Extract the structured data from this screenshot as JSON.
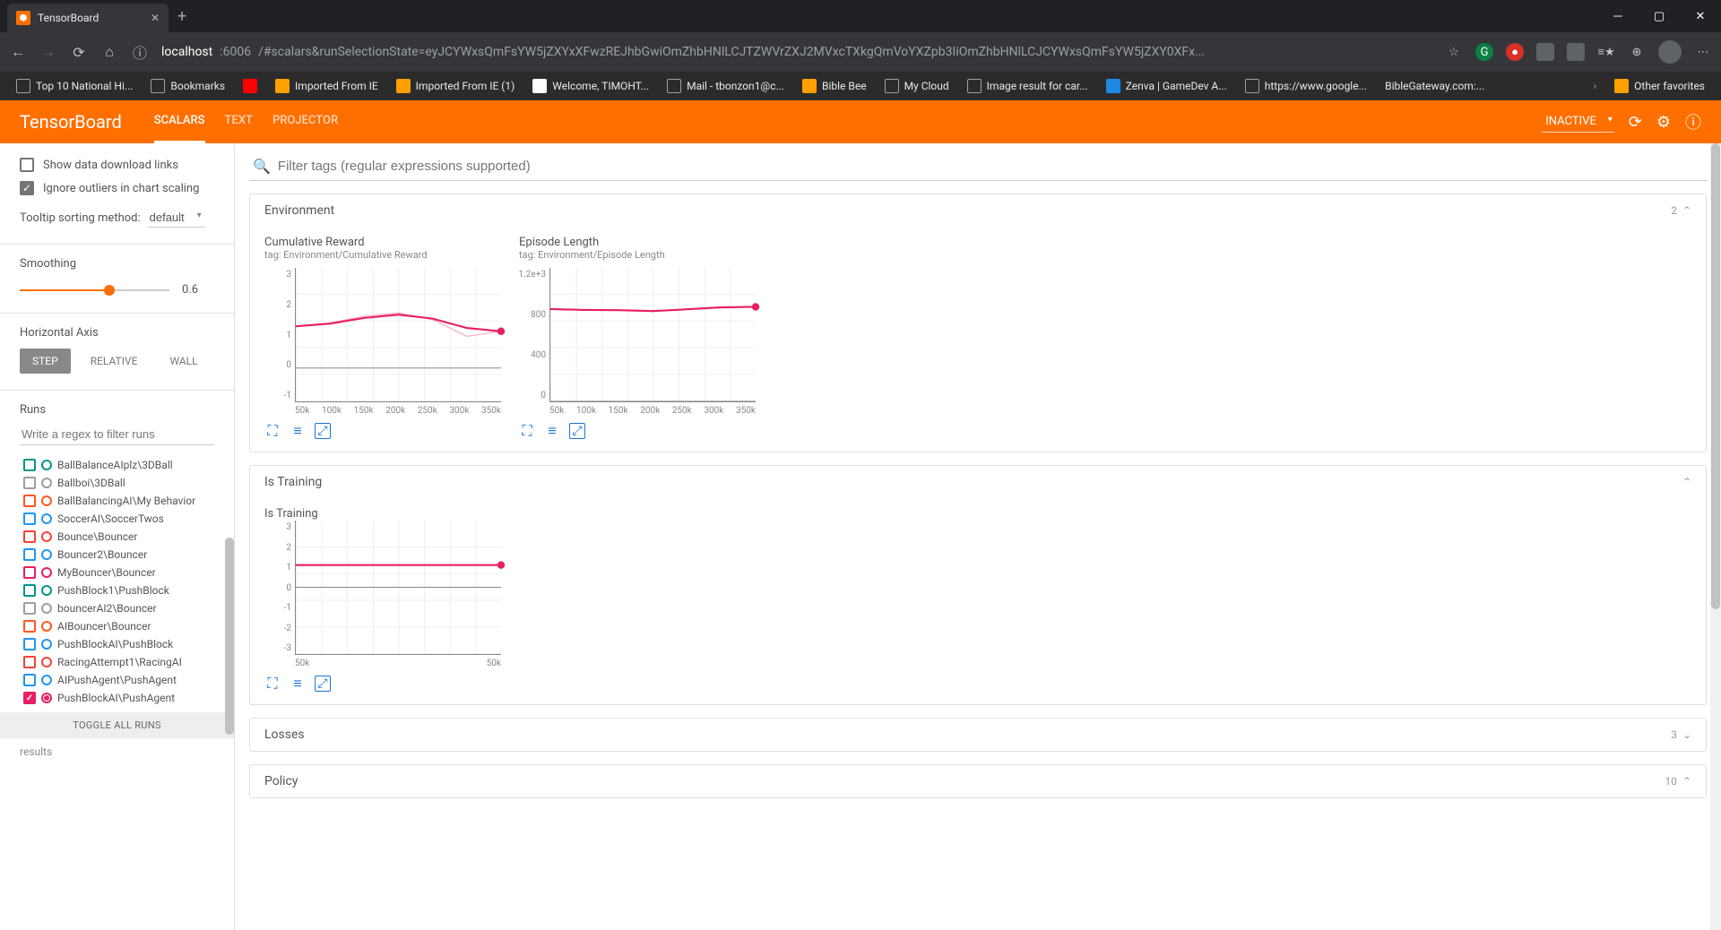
{
  "browser": {
    "tab_title": "TensorBoard",
    "url_host": "localhost",
    "url_port": ":6006",
    "url_path": "/#scalars&runSelectionState=eyJCYWxsQmFsYW5jZXYxXFwzREJhbGwiOmZhbHNlLCJTZWVrZXJ2MVxcTXkgQmVoYXZpb3IiOmZhbHNlLCJCYWxsQmFsYW5jZXY0XFx...",
    "bookmarks": [
      "Top 10 National Hi...",
      "Bookmarks",
      "",
      "Imported From IE",
      "Imported From IE (1)",
      "Welcome, TIMOHT...",
      "Mail - tbonzon1@c...",
      "Bible Bee",
      "My Cloud",
      "Image result for car...",
      "Zenva | GameDev A...",
      "https://www.google...",
      "BibleGateway.com:..."
    ],
    "other_favorites": "Other favorites"
  },
  "header": {
    "logo": "TensorBoard",
    "tabs": [
      "SCALARS",
      "TEXT",
      "PROJECTOR"
    ],
    "active_tab": 0,
    "inactive_label": "INACTIVE"
  },
  "sidebar": {
    "show_dl": "Show data download links",
    "ignore_outliers": "Ignore outliers in chart scaling",
    "tooltip_label": "Tooltip sorting method:",
    "tooltip_value": "default",
    "smoothing_label": "Smoothing",
    "smoothing_value": "0.6",
    "smoothing_pct": 60,
    "haxis_label": "Horizontal Axis",
    "haxis_btns": [
      "STEP",
      "RELATIVE",
      "WALL"
    ],
    "runs_label": "Runs",
    "runs_filter_placeholder": "Write a regex to filter runs",
    "runs": [
      {
        "name": "BallBalanceAIplz\\3DBall",
        "color": "#009688",
        "checked": false,
        "radio": false
      },
      {
        "name": "Ballboi\\3DBall",
        "color": "#9e9e9e",
        "checked": false,
        "radio": false
      },
      {
        "name": "BallBalancingAI\\My Behavior",
        "color": "#ff5722",
        "checked": false,
        "radio": false
      },
      {
        "name": "SoccerAI\\SoccerTwos",
        "color": "#2196f3",
        "checked": false,
        "radio": false
      },
      {
        "name": "Bounce\\Bouncer",
        "color": "#f44336",
        "checked": false,
        "radio": false
      },
      {
        "name": "Bouncer2\\Bouncer",
        "color": "#2196f3",
        "checked": false,
        "radio": false
      },
      {
        "name": "MyBouncer\\Bouncer",
        "color": "#e91e63",
        "checked": false,
        "radio": false
      },
      {
        "name": "PushBlock1\\PushBlock",
        "color": "#009688",
        "checked": false,
        "radio": false
      },
      {
        "name": "bouncerAI2\\Bouncer",
        "color": "#9e9e9e",
        "checked": false,
        "radio": false
      },
      {
        "name": "AIBouncer\\Bouncer",
        "color": "#ff5722",
        "checked": false,
        "radio": false
      },
      {
        "name": "PushBlockAI\\PushBlock",
        "color": "#2196f3",
        "checked": false,
        "radio": false
      },
      {
        "name": "RacingAttempt1\\RacingAI",
        "color": "#f44336",
        "checked": false,
        "radio": false
      },
      {
        "name": "AIPushAgent\\PushAgent",
        "color": "#2196f3",
        "checked": false,
        "radio": false
      },
      {
        "name": "PushBlockAI\\PushAgent",
        "color": "#e91e63",
        "checked": true,
        "radio": true
      }
    ],
    "toggle_all": "TOGGLE ALL RUNS",
    "footer": "results"
  },
  "main": {
    "filter_placeholder": "Filter tags (regular expressions supported)",
    "sections": {
      "env": {
        "title": "Environment",
        "count": "2"
      },
      "istraining": {
        "title": "Is Training",
        "count": ""
      },
      "losses": {
        "title": "Losses",
        "count": "3"
      },
      "policy": {
        "title": "Policy",
        "count": "10"
      }
    }
  },
  "chart_data": [
    {
      "type": "line",
      "title": "Cumulative Reward",
      "tag": "tag: Environment/Cumulative Reward",
      "x": [
        50000,
        100000,
        150000,
        200000,
        250000,
        300000,
        350000
      ],
      "xticks": [
        "50k",
        "100k",
        "150k",
        "200k",
        "250k",
        "300k",
        "350k"
      ],
      "series": [
        {
          "name": "PushBlockAI\\PushAgent",
          "color": "#e91e63",
          "values": [
            1.25,
            1.35,
            1.55,
            1.65,
            1.45,
            0.95,
            1.1
          ],
          "smooth": [
            1.25,
            1.33,
            1.5,
            1.6,
            1.48,
            1.2,
            1.1
          ]
        }
      ],
      "yticks": [
        "-1",
        "0",
        "1",
        "2",
        "3"
      ],
      "ylim": [
        -1,
        3
      ]
    },
    {
      "type": "line",
      "title": "Episode Length",
      "tag": "tag: Environment/Episode Length",
      "x": [
        50000,
        100000,
        150000,
        200000,
        250000,
        300000,
        350000
      ],
      "xticks": [
        "50k",
        "100k",
        "150k",
        "200k",
        "250k",
        "300k",
        "350k"
      ],
      "series": [
        {
          "name": "PushBlockAI\\PushAgent",
          "color": "#e91e63",
          "values": [
            830,
            820,
            820,
            810,
            830,
            850,
            850
          ],
          "smooth": [
            830,
            822,
            820,
            812,
            828,
            845,
            850
          ]
        }
      ],
      "yticks": [
        "0",
        "400",
        "800",
        "1.2e+3"
      ],
      "ylim": [
        0,
        1200
      ]
    },
    {
      "type": "line",
      "title": "Is Training",
      "tag": "",
      "x": [
        50000,
        50000
      ],
      "xticks": [
        "50k",
        "50k"
      ],
      "series": [
        {
          "name": "PushBlockAI\\PushAgent",
          "color": "#e91e63",
          "values": [
            1,
            1
          ],
          "smooth": [
            1,
            1
          ]
        }
      ],
      "yticks": [
        "-3",
        "-2",
        "-1",
        "0",
        "1",
        "2",
        "3"
      ],
      "ylim": [
        -3,
        3
      ]
    }
  ]
}
